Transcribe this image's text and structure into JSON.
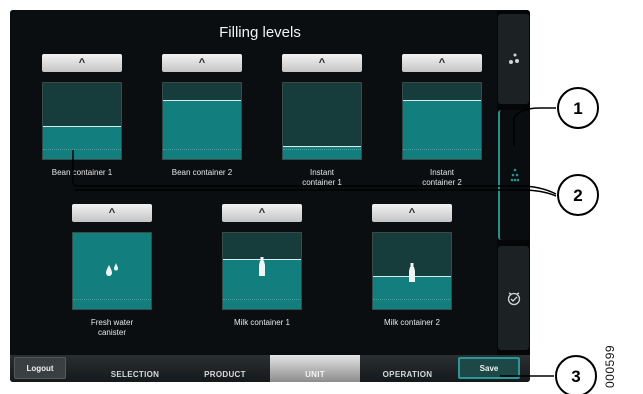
{
  "screen": {
    "title": "Filling levels",
    "containers": [
      {
        "name": "bean-container-1",
        "label_lines": [
          "Bean container 1"
        ],
        "level": 0.44,
        "icon": ""
      },
      {
        "name": "bean-container-2",
        "label_lines": [
          "Bean container 2"
        ],
        "level": 0.78,
        "icon": ""
      },
      {
        "name": "instant-container-1",
        "label_lines": [
          "Instant",
          "container 1"
        ],
        "level": 0.17,
        "icon": ""
      },
      {
        "name": "instant-container-2",
        "label_lines": [
          "Instant",
          "container 2"
        ],
        "level": 0.78,
        "icon": ""
      },
      {
        "name": "fresh-water-canister",
        "label_lines": [
          "Fresh water",
          "canister"
        ],
        "level": 1.0,
        "icon": "water-drops-icon"
      },
      {
        "name": "milk-container-1",
        "label_lines": [
          "Milk container 1"
        ],
        "level": 0.66,
        "icon": "milk-bottle-icon"
      },
      {
        "name": "milk-container-2",
        "label_lines": [
          "Milk container 2"
        ],
        "level": 0.44,
        "icon": "milk-bottle-icon"
      }
    ],
    "up_button_glyph": "^",
    "sidebar": [
      {
        "icon": "water-drops-icon",
        "active": false
      },
      {
        "icon": "dosage-dots-icon",
        "active": true
      },
      {
        "icon": "timer-check-icon",
        "active": false
      }
    ],
    "bottom_nav": {
      "logout_label": "Logout",
      "tabs": [
        {
          "label": "SELECTION",
          "active": false
        },
        {
          "label": "PRODUCT",
          "active": false
        },
        {
          "label": "UNIT",
          "active": true
        },
        {
          "label": "OPERATION",
          "active": false
        }
      ],
      "save_label": "Save"
    },
    "colors": {
      "fill": "#127e7d",
      "empty": "#173c3c",
      "accent": "#2a9897"
    }
  },
  "callouts": [
    "1",
    "2",
    "3"
  ],
  "figure_code": "000599"
}
